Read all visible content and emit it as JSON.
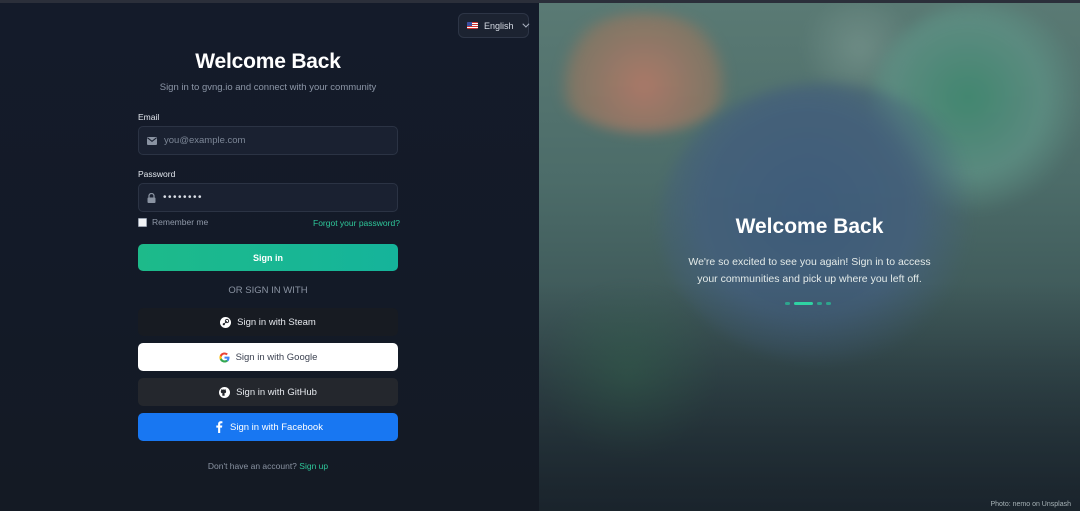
{
  "header": {
    "language": "English",
    "language_icon": "us-flag-icon"
  },
  "left": {
    "title": "Welcome Back",
    "subtitle": "Sign in to gvng.io and connect with your community",
    "email_label": "Email",
    "email_placeholder": "you@example.com",
    "password_label": "Password",
    "password_value": "••••••••",
    "remember_label": "Remember me",
    "forgot_link": "Forgot your password?",
    "signin_button": "Sign in",
    "or_text": "OR SIGN IN WITH",
    "social": {
      "steam": "Sign in with Steam",
      "google": "Sign in with Google",
      "github": "Sign in with GitHub",
      "facebook": "Sign in with Facebook"
    },
    "footer_text": "Don't have an account?",
    "signup_link": "Sign up"
  },
  "right": {
    "title": "Welcome Back",
    "description": "We're so excited to see you again! Sign in to access your communities and pick up where you left off.",
    "carousel": {
      "count": 4,
      "active_index": 1
    },
    "credit": "Photo: nemo on Unsplash"
  },
  "colors": {
    "accent": "#1dba8a",
    "facebook": "#1877f2",
    "background": "#141b2a"
  }
}
